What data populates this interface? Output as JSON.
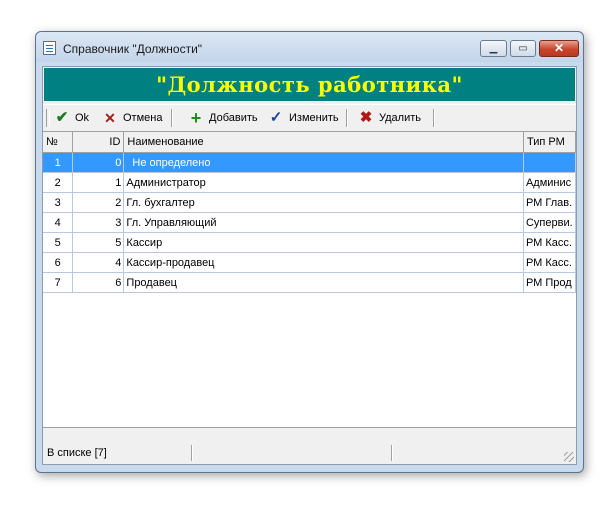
{
  "window": {
    "title": "Справочник \"Должности\""
  },
  "banner": {
    "text": "\"Должность работника\""
  },
  "toolbar": {
    "ok_label": "Ok",
    "cancel_label": "Отмена",
    "add_label": "Добавить",
    "edit_label": "Изменить",
    "delete_label": "Удалить",
    "icons": {
      "ok": "check-icon",
      "cancel": "x-icon",
      "add": "plus-icon",
      "edit": "pencil-check-icon",
      "delete": "delete-x-icon"
    }
  },
  "table": {
    "columns": [
      "№",
      "ID",
      "Наименование",
      "Тип РМ"
    ],
    "rows": [
      {
        "num": "1",
        "id": "0",
        "name": "Не определено",
        "type": "",
        "selected": true
      },
      {
        "num": "2",
        "id": "1",
        "name": "Администратор",
        "type": "Админис"
      },
      {
        "num": "3",
        "id": "2",
        "name": "Гл. бухгалтер",
        "type": "РМ Глав."
      },
      {
        "num": "4",
        "id": "3",
        "name": "Гл. Управляющий",
        "type": "Суперви."
      },
      {
        "num": "5",
        "id": "5",
        "name": "Кассир",
        "type": "РМ Касс."
      },
      {
        "num": "6",
        "id": "4",
        "name": "Кассир-продавец",
        "type": "РМ Касс."
      },
      {
        "num": "7",
        "id": "6",
        "name": "Продавец",
        "type": "РМ Прод"
      }
    ]
  },
  "status": {
    "text": "В списке [7]"
  },
  "colors": {
    "banner_bg": "#008080",
    "banner_text": "#ffff00",
    "selection": "#3399ff"
  }
}
